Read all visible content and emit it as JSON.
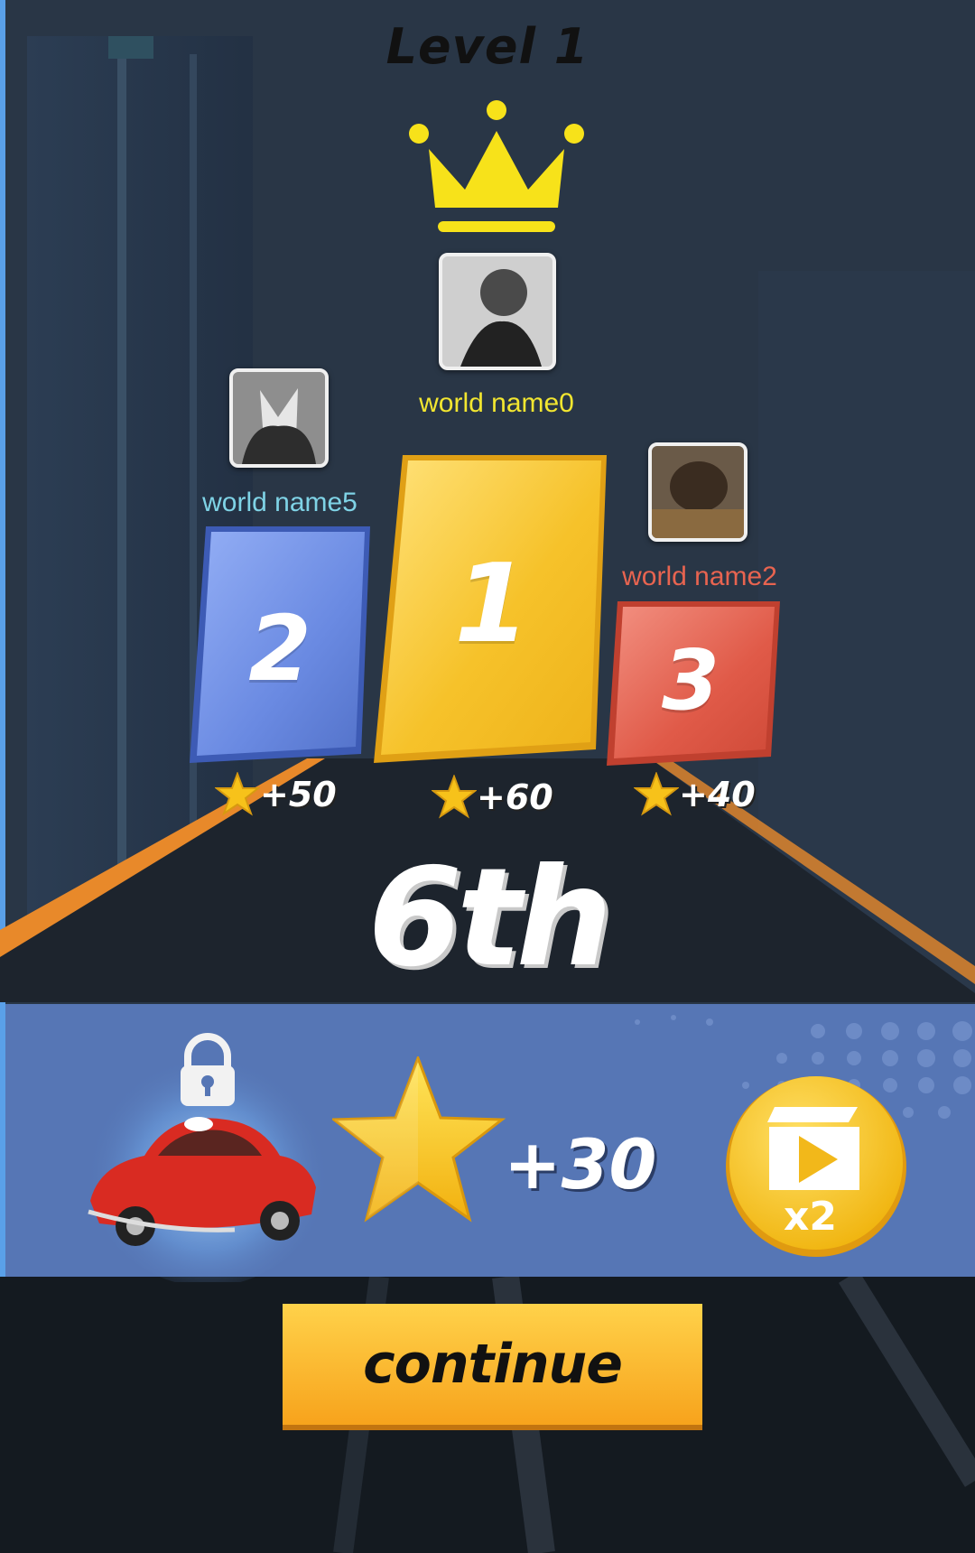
{
  "header": {
    "level_title": "Level 1"
  },
  "podium": [
    {
      "place": "1",
      "player_name": "world name0",
      "name_color": "#f2e630",
      "reward": "+60"
    },
    {
      "place": "2",
      "player_name": "world name5",
      "name_color": "#7fd3e6",
      "reward": "+50"
    },
    {
      "place": "3",
      "player_name": "world name2",
      "name_color": "#e86450",
      "reward": "+40"
    }
  ],
  "result": {
    "rank": "6th"
  },
  "reward_panel": {
    "star_reward": "+30",
    "double_label": "x2",
    "car_locked": true
  },
  "actions": {
    "continue_label": "continue"
  },
  "colors": {
    "gold": "#f6c22a",
    "blue": "#6a8ae2",
    "red": "#e05a48",
    "panel": "#5676b5"
  },
  "icons": [
    "crown-icon",
    "star-icon",
    "lock-icon",
    "video-icon",
    "car-image",
    "avatar-image"
  ]
}
